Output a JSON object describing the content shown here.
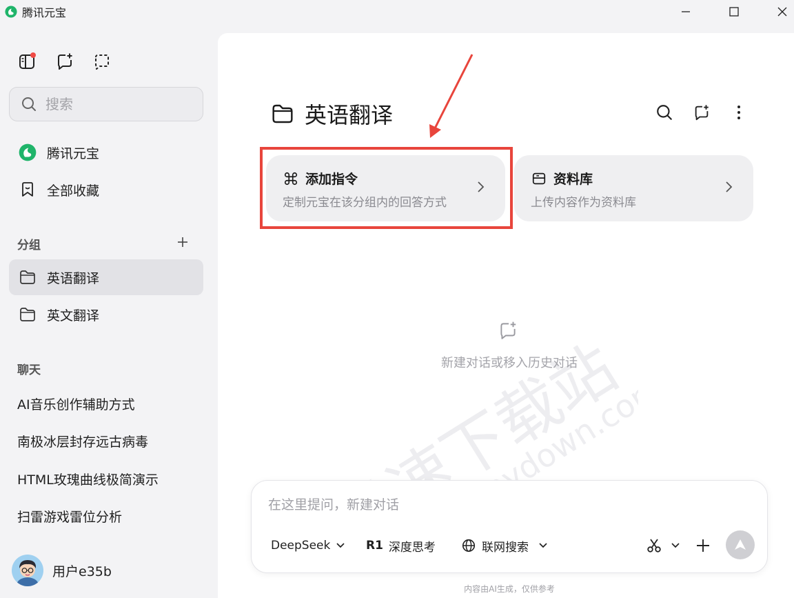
{
  "window": {
    "title": "腾讯元宝"
  },
  "sidebar": {
    "search_placeholder": "搜索",
    "nav": {
      "yuanbao": "腾讯元宝",
      "favorites": "全部收藏"
    },
    "groups_label": "分组",
    "groups": [
      {
        "label": "英语翻译",
        "active": true
      },
      {
        "label": "英文翻译",
        "active": false
      }
    ],
    "chats_label": "聊天",
    "chats": [
      "AI音乐创作辅助方式",
      "南极冰层封存远古病毒",
      "HTML玫瑰曲线极简演示",
      "扫雷游戏雷位分析"
    ],
    "user": {
      "name": "用户e35b"
    }
  },
  "main": {
    "folder_title": "英语翻译",
    "cards": [
      {
        "title": "添加指令",
        "subtitle": "定制元宝在该分组内的回答方式",
        "icon": "command-icon"
      },
      {
        "title": "资料库",
        "subtitle": "上传内容作为资料库",
        "icon": "library-icon"
      }
    ],
    "empty_text": "新建对话或移入历史对话",
    "watermark": {
      "line1": "极速下载站",
      "line2": "www.mydown.com"
    },
    "input": {
      "placeholder": "在这里提问，新建对话",
      "model": "DeepSeek",
      "deep_think": "深度思考",
      "deep_think_badge": "R1",
      "web_search": "联网搜索"
    },
    "footer": "内容由AI生成，仅供参考"
  },
  "colors": {
    "highlight": "#e8453c",
    "brand_green": "#1fb46a"
  }
}
